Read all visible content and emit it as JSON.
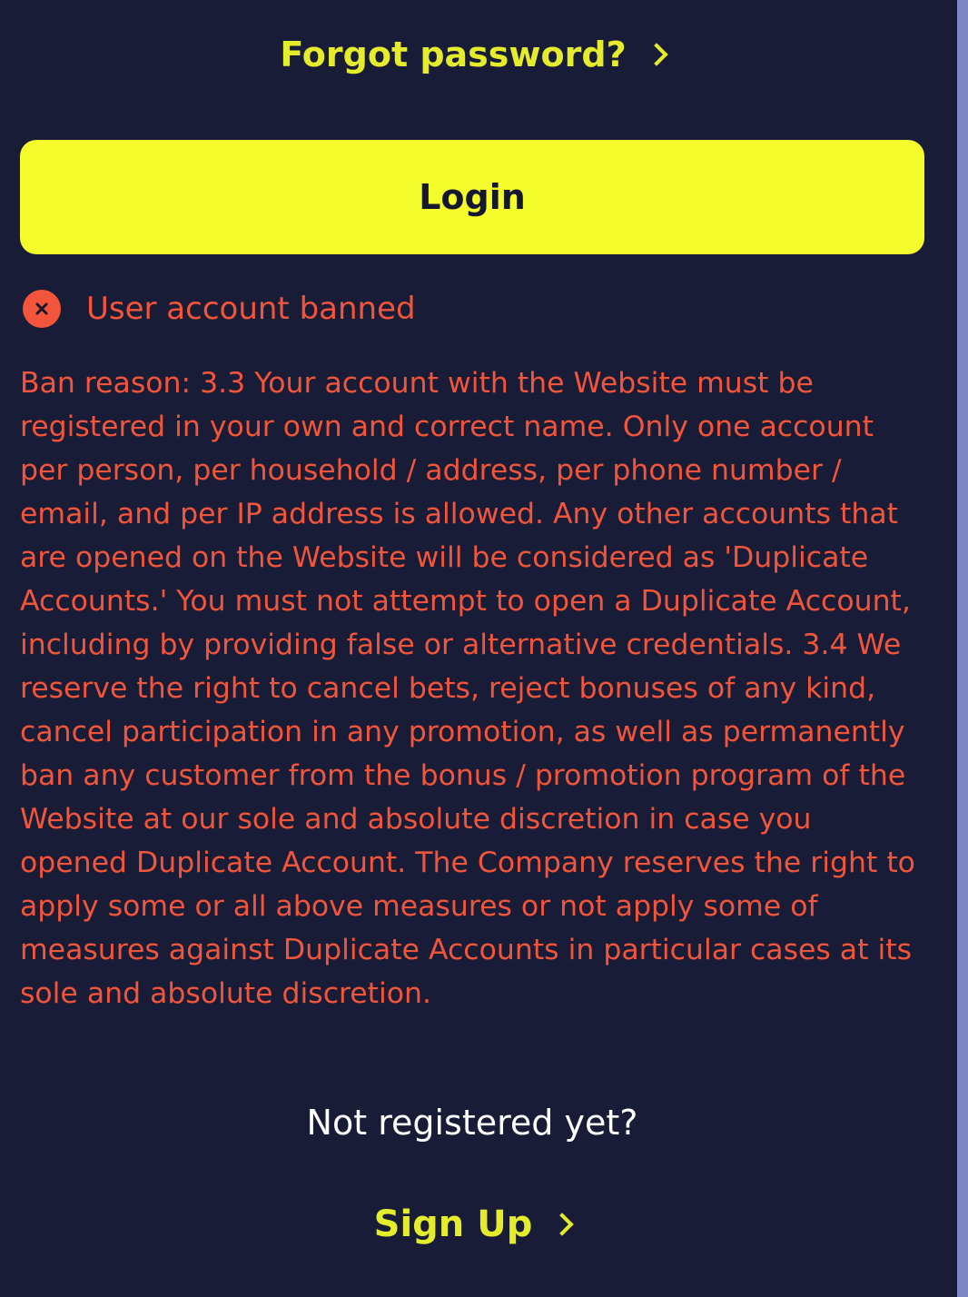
{
  "links": {
    "forgot_password": "Forgot password?",
    "sign_up": "Sign Up"
  },
  "login_button": {
    "label": "Login"
  },
  "error": {
    "title": "User account banned",
    "icon": "close-circle-icon",
    "ban_reason": "Ban reason: 3.3 Your account with the Website must be registered in your own and correct name. Only one account per person, per household / address, per phone number / email, and per IP address is allowed. Any other accounts that are opened on the Website will be considered as 'Duplicate Accounts.' You must not attempt to open a Duplicate Account, including by providing false or alternative credentials. 3.4 We reserve the right to cancel bets, reject bonuses of any kind, cancel participation in any promotion, as well as permanently ban any customer from the bonus / promotion program of the Website at our sole and absolute discretion in case you opened Duplicate Account. The Company reserves the right to apply some or all above measures or not apply some of measures against Duplicate Accounts in particular cases at its sole and absolute discretion."
  },
  "register_prompt": "Not registered yet?",
  "colors": {
    "background": "#181c36",
    "accent_yellow": "#f5fc2c",
    "link_yellow": "#e4ec2c",
    "error_red": "#f2553a",
    "scrollbar": "#7e88c4"
  }
}
